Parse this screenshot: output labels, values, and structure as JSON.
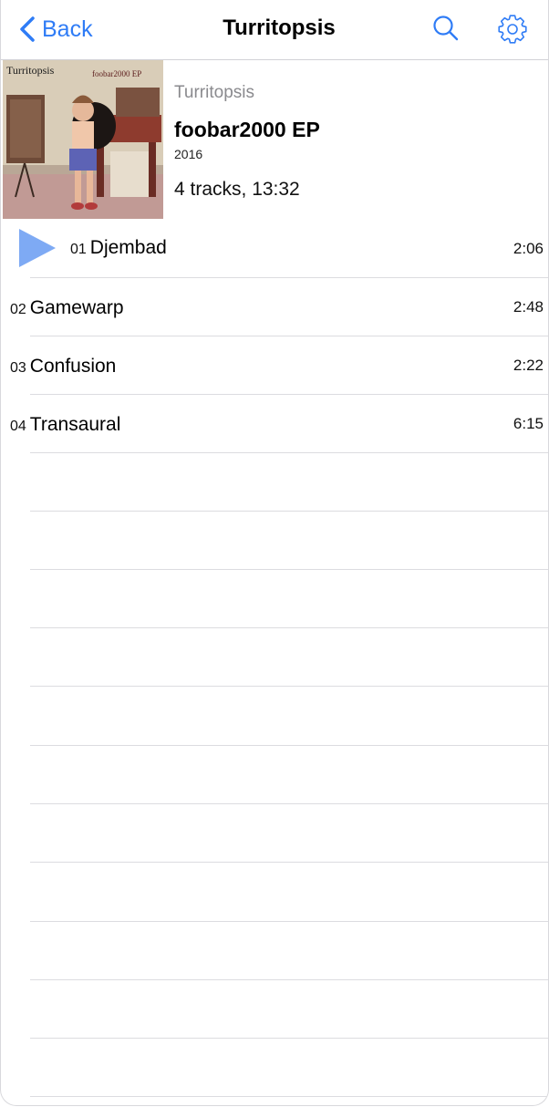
{
  "nav": {
    "back_label": "Back",
    "title": "Turritopsis",
    "search_icon": "search-icon",
    "settings_icon": "gear-icon",
    "accent_color": "#2f7cf6"
  },
  "album": {
    "cover_artist_text": "Turritopsis",
    "cover_title_text": "foobar2000 EP",
    "artist": "Turritopsis",
    "title": "foobar2000 EP",
    "year": "2016",
    "summary": "4 tracks, 13:32"
  },
  "tracks": [
    {
      "number": "01",
      "title": "Djembad",
      "duration": "2:06",
      "playing": true
    },
    {
      "number": "02",
      "title": "Gamewarp",
      "duration": "2:48",
      "playing": false
    },
    {
      "number": "03",
      "title": "Confusion",
      "duration": "2:22",
      "playing": false
    },
    {
      "number": "04",
      "title": "Transaural",
      "duration": "6:15",
      "playing": false
    }
  ],
  "play_indicator": {
    "icon": "play-icon",
    "color": "#7eaaf4"
  }
}
